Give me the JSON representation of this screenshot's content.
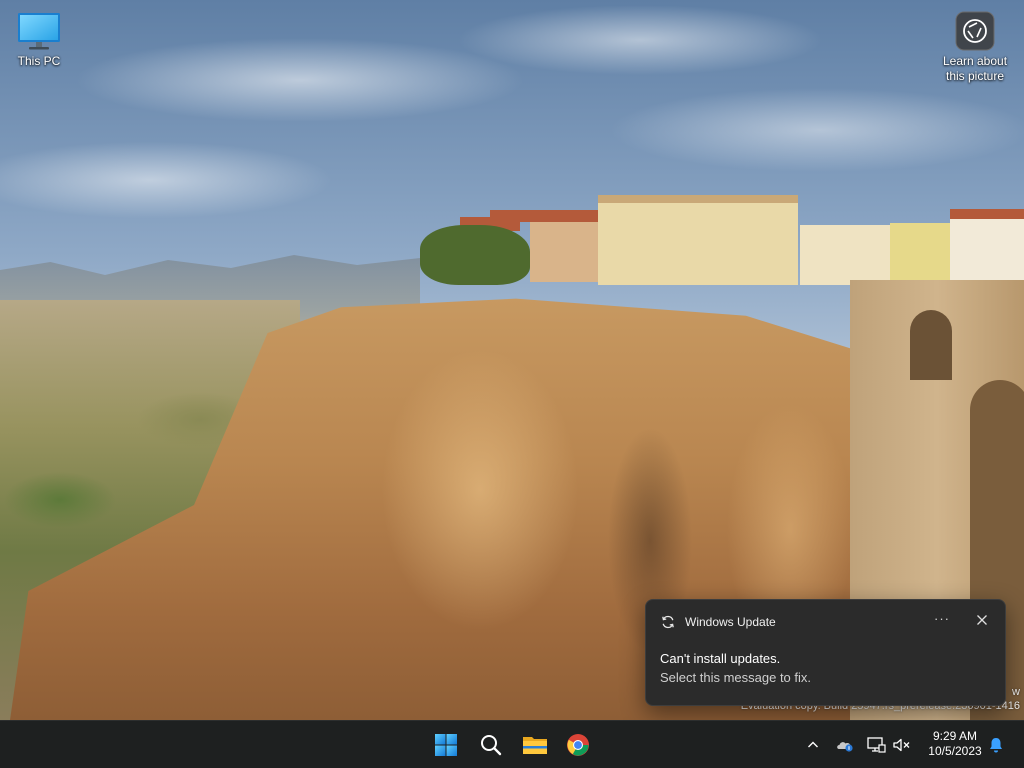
{
  "desktop": {
    "icons": [
      {
        "label": "This PC",
        "icon": "monitor-icon"
      },
      {
        "label": "Learn about this picture",
        "icon": "camera-lens-icon"
      }
    ],
    "watermark": {
      "line1": "w",
      "line2": "Evaluation copy. Build 25947.rs_prerelease.230901-1416"
    }
  },
  "toast": {
    "app_name": "Windows Update",
    "app_icon": "refresh-icon",
    "more_label": "···",
    "title": "Can't install updates.",
    "body": "Select this message to fix."
  },
  "taskbar": {
    "pinned": [
      {
        "name": "Start",
        "icon": "windows-logo-icon"
      },
      {
        "name": "Search",
        "icon": "search-icon"
      },
      {
        "name": "File Explorer",
        "icon": "folder-icon"
      },
      {
        "name": "Google Chrome",
        "icon": "chrome-icon"
      }
    ],
    "tray": {
      "icons": [
        "chevron-up-icon",
        "onedrive-icon",
        "network-icon",
        "volume-muted-icon"
      ],
      "time": "9:29 AM",
      "date": "10/5/2023",
      "notification_icon": "bell-icon"
    }
  },
  "colors": {
    "taskbar": "#1e2020",
    "toast_bg": "#2b2b2b",
    "windows_blue": "#1e9bf0"
  }
}
